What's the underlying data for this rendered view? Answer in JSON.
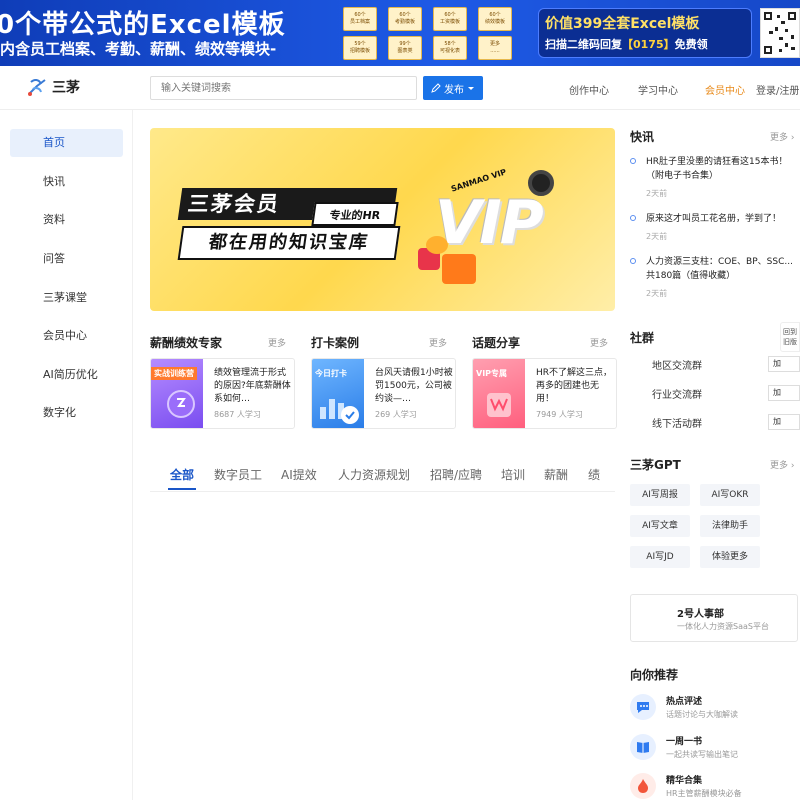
{
  "banner": {
    "line1": "0个带公式的Excel模板",
    "line2": "内含员工档案、考勤、薪酬、绩效等模块-",
    "tiles": [
      {
        "count": "60个",
        "name": "员工档案"
      },
      {
        "count": "60个",
        "name": "考勤模板"
      },
      {
        "count": "60个",
        "name": "工资模板"
      },
      {
        "count": "60个",
        "name": "绩效模板"
      },
      {
        "count": "59个",
        "name": "招聘模板"
      },
      {
        "count": "99个",
        "name": "图表类"
      },
      {
        "count": "58个",
        "name": "可视化表"
      },
      {
        "count": "更多",
        "name": "......"
      }
    ],
    "promo_title": "价值399全套Excel模板",
    "promo_sub_prefix": "扫描二维码回复",
    "promo_code": "【0175】",
    "promo_sub_suffix": "免费领"
  },
  "header": {
    "logo_text": "三茅",
    "search_placeholder": "输入关键词搜索",
    "publish_label": "发布",
    "nav": [
      "创作中心",
      "学习中心",
      "会员中心",
      "登录/注册"
    ]
  },
  "sidebar": {
    "items": [
      "首页",
      "快讯",
      "资料",
      "问答",
      "三茅课堂",
      "会员中心",
      "AI简历优化",
      "数字化"
    ]
  },
  "hero": {
    "title": "三茅会员",
    "tag": "专业的HR",
    "subtitle": "都在用的知识宝库",
    "vip": "VIP",
    "en": "SANMAO VIP"
  },
  "sections": [
    {
      "title": "薪酬绩效专家",
      "more": "更多",
      "thumb_tag": "实战训练营",
      "text": "绩效管理流于形式的原因?年底薪酬体系如何…",
      "count": "8687 人学习"
    },
    {
      "title": "打卡案例",
      "more": "更多",
      "thumb_tag": "今日打卡",
      "text": "台风天请假1小时被罚1500元，公司被约谈—…",
      "count": "269 人学习"
    },
    {
      "title": "话题分享",
      "more": "更多",
      "thumb_tag": "VIP专属",
      "text": "HR不了解这三点，再多的团建也无用！",
      "count": "7949 人学习"
    }
  ],
  "tabs": [
    "全部",
    "数字员工",
    "AI提效",
    "人力资源规划",
    "招聘/应聘",
    "培训",
    "薪酬",
    "绩"
  ],
  "right": {
    "news_title": "快讯",
    "news_more": "更多 ›",
    "news": [
      {
        "text": "HR肚子里没墨的请狂看这15本书！（附电子书合集）",
        "time": "2天前"
      },
      {
        "text": "原来这才叫员工花名册，学到了！",
        "time": "2天前"
      },
      {
        "text": "人力资源三支柱：COE、BP、SSC...共180篇（值得收藏）",
        "time": "2天前"
      }
    ],
    "community_title": "社群",
    "groups": [
      "地区交流群",
      "行业交流群",
      "线下活动群"
    ],
    "group_btn": "加",
    "float_text": "回到旧版",
    "gpt_title": "三茅GPT",
    "gpt_more": "更多 ›",
    "gpt_buttons": [
      "AI写周报",
      "AI写OKR",
      "AI写文章",
      "法律助手",
      "AI写JD",
      "体验更多"
    ],
    "saas_title": "2号人事部",
    "saas_sub": "一体化人力资源SaaS平台",
    "rec_title": "向你推荐",
    "recs": [
      {
        "title": "热点评述",
        "sub": "话题讨论与大咖解读"
      },
      {
        "title": "一周一书",
        "sub": "一起共读写输出笔记"
      },
      {
        "title": "精华合集",
        "sub": "HR主管薪酬模块必备"
      }
    ]
  },
  "colors": {
    "brand": "#1a73e8",
    "active": "#1a56c8",
    "vip_orange": "#ff8a00"
  }
}
